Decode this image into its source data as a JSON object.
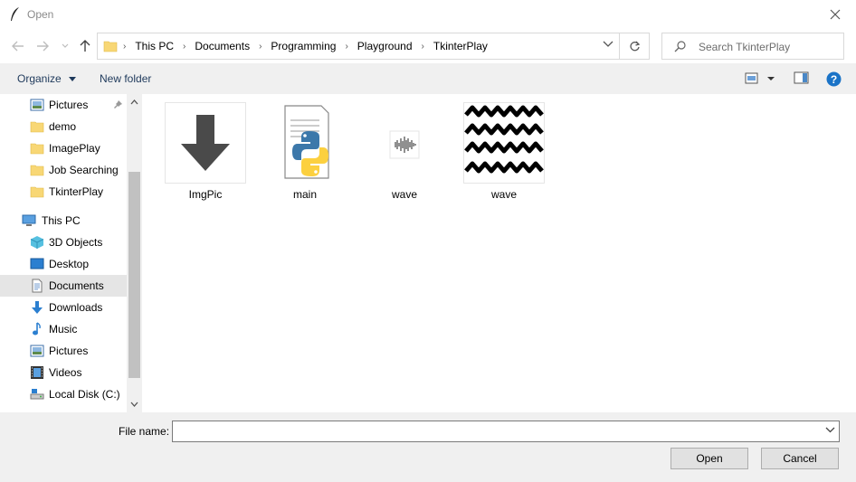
{
  "window": {
    "title": "Open"
  },
  "address": {
    "crumbs": [
      "This PC",
      "Documents",
      "Programming",
      "Playground",
      "TkinterPlay"
    ]
  },
  "search": {
    "placeholder": "Search TkinterPlay"
  },
  "toolbar": {
    "organize_label": "Organize",
    "new_folder_label": "New folder"
  },
  "nav": {
    "items": [
      {
        "label": "Pictures",
        "icon": "pictures-icon",
        "pinned": true
      },
      {
        "label": "demo",
        "icon": "folder-icon"
      },
      {
        "label": "ImagePlay",
        "icon": "folder-icon"
      },
      {
        "label": "Job Searching",
        "icon": "folder-icon"
      },
      {
        "label": "TkinterPlay",
        "icon": "folder-icon"
      },
      {
        "label": "This PC",
        "icon": "pc-icon"
      },
      {
        "label": "3D Objects",
        "icon": "3d-objects-icon"
      },
      {
        "label": "Desktop",
        "icon": "desktop-icon"
      },
      {
        "label": "Documents",
        "icon": "documents-icon",
        "selected": true
      },
      {
        "label": "Downloads",
        "icon": "downloads-icon"
      },
      {
        "label": "Music",
        "icon": "music-icon"
      },
      {
        "label": "Pictures",
        "icon": "pictures-icon"
      },
      {
        "label": "Videos",
        "icon": "videos-icon"
      },
      {
        "label": "Local Disk (C:)",
        "icon": "local-disk-icon"
      }
    ]
  },
  "files": [
    {
      "name": "ImgPic",
      "icon": "download-arrow-thumbnail"
    },
    {
      "name": "main",
      "icon": "python-file-icon"
    },
    {
      "name": "wave",
      "icon": "audio-wave-icon"
    },
    {
      "name": "wave",
      "icon": "zigzag-image-thumbnail"
    }
  ],
  "footer": {
    "file_name_label": "File name:",
    "file_name_value": "",
    "open_label": "Open",
    "cancel_label": "Cancel"
  }
}
